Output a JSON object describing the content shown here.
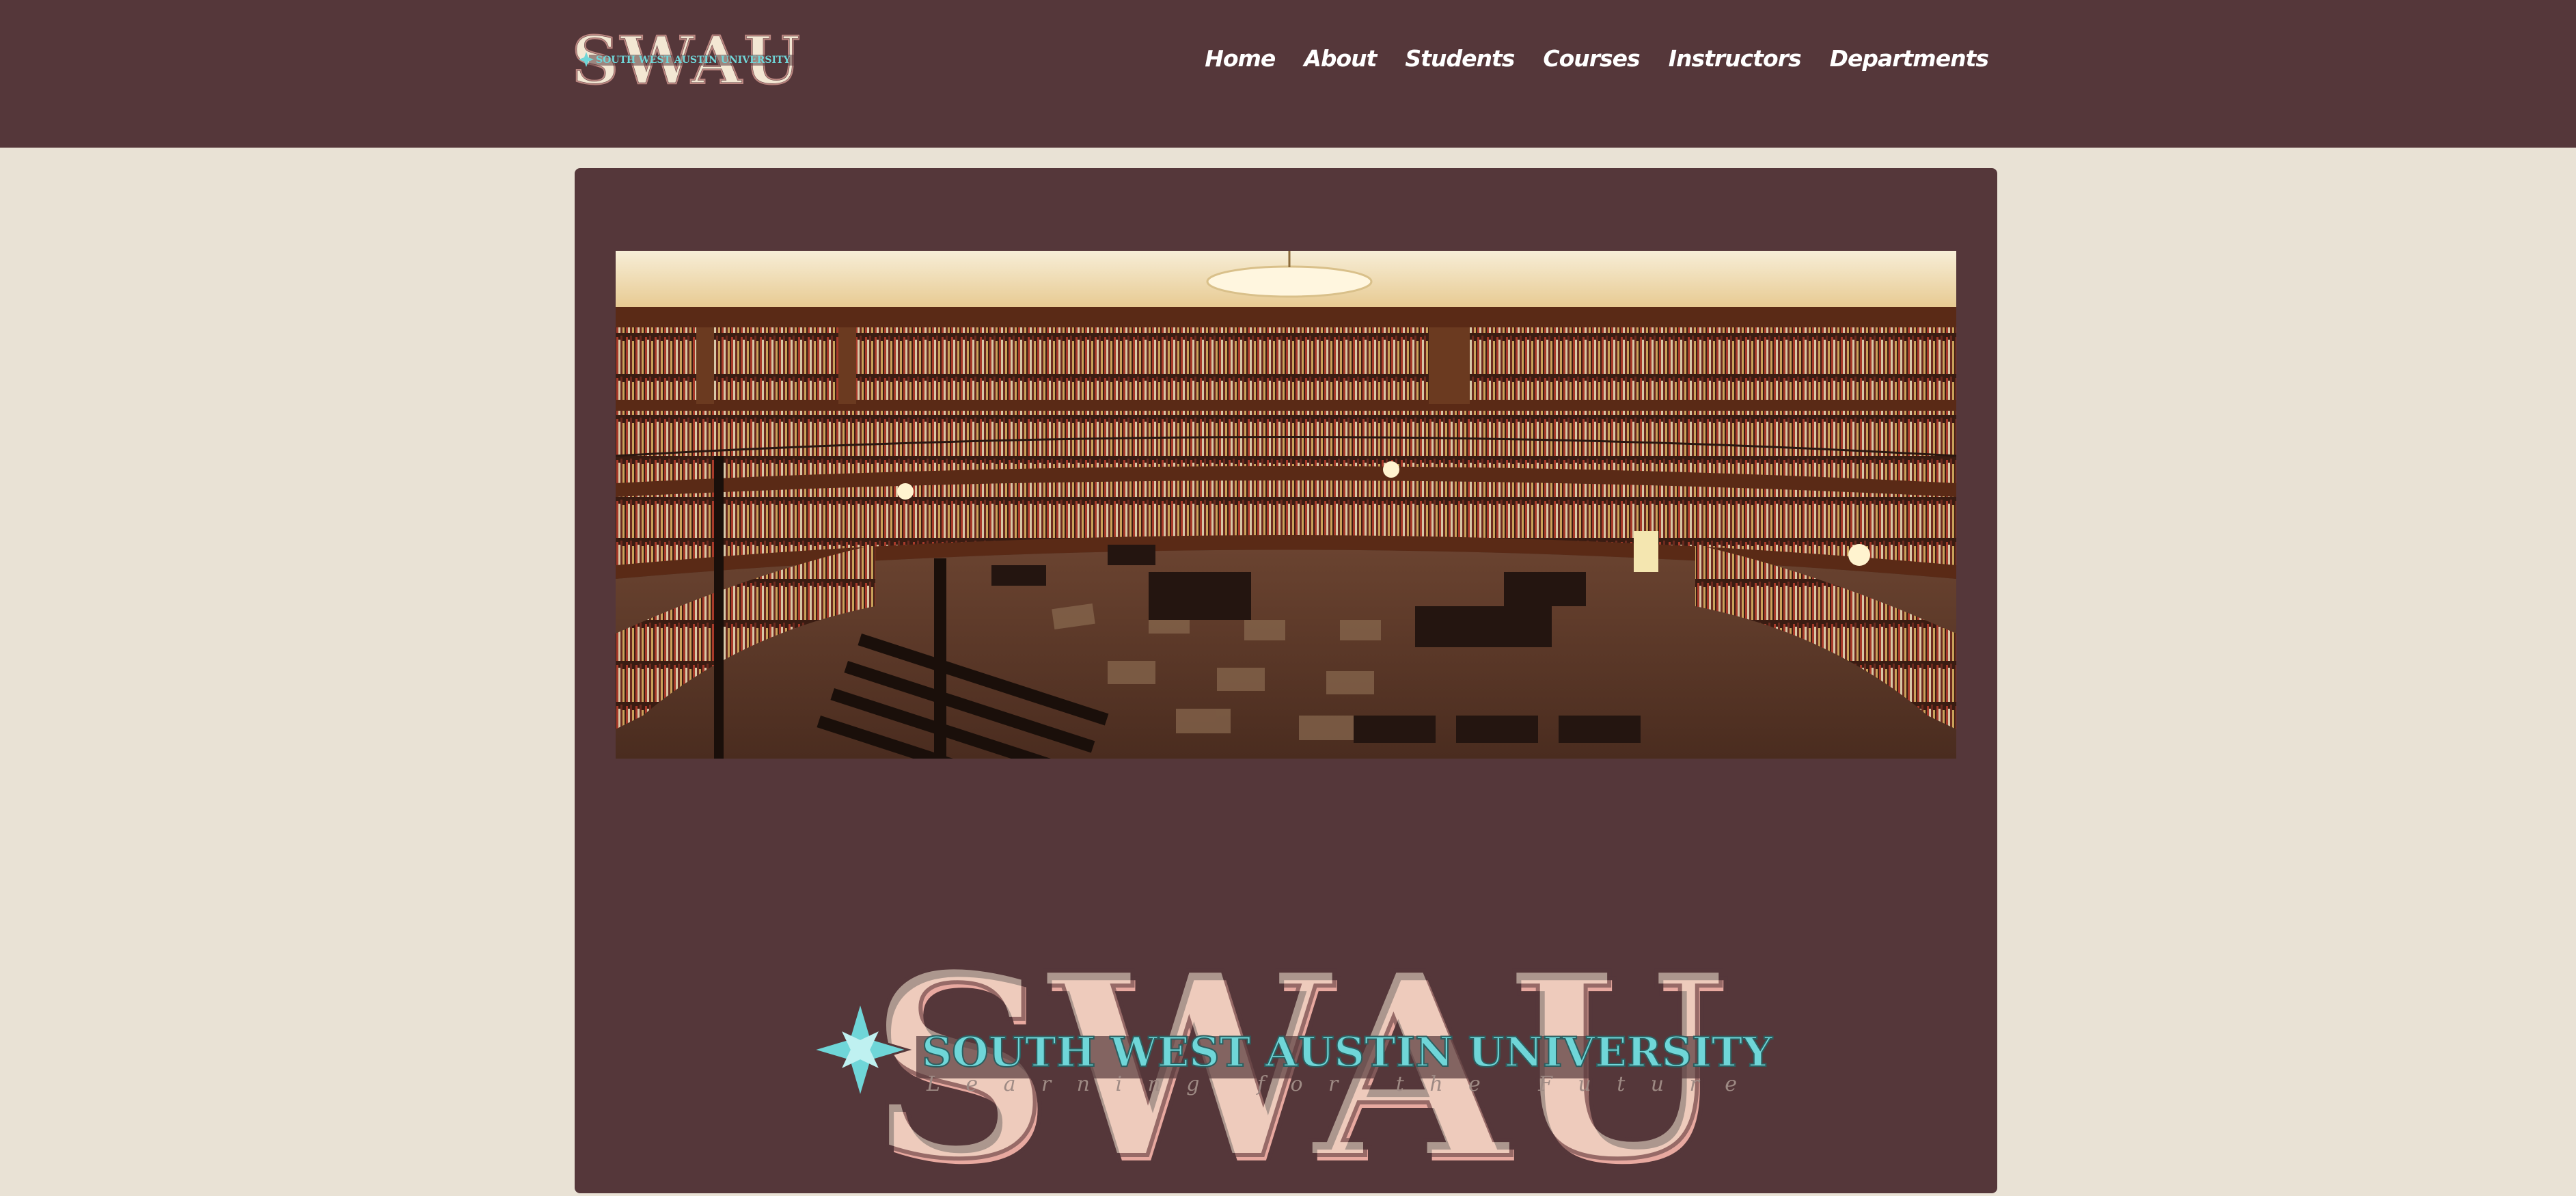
{
  "brand": {
    "logo_text": "SWAU",
    "university_name": "SOUTH WEST AUSTIN UNIVERSITY",
    "tagline": "Learning for the Future"
  },
  "nav": {
    "items": [
      "Home",
      "About",
      "Students",
      "Courses",
      "Instructors",
      "Departments"
    ]
  },
  "hero": {
    "icon": "library-panorama-image"
  },
  "colors": {
    "header_bg": "#55373a",
    "page_bg": "#e9e2d5",
    "logo_pink": "#e8a9a0",
    "logo_cream": "#f3e7d3",
    "logo_teal": "#6fd6d8"
  }
}
